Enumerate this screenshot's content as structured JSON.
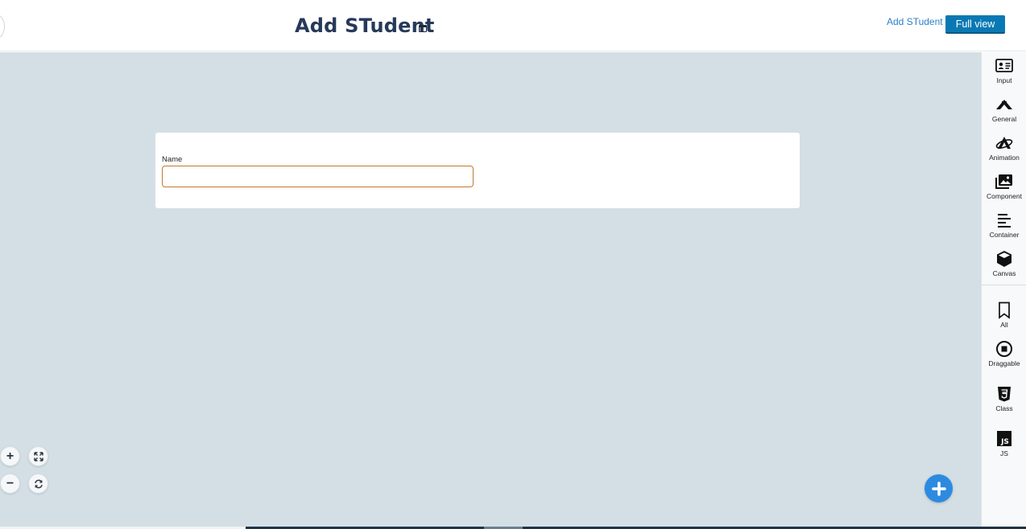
{
  "header": {
    "title": "Add STudent",
    "link_label": "Add STudent",
    "full_view_label": "Full view"
  },
  "form": {
    "name_label": "Name",
    "name_value": "",
    "name_placeholder": ""
  },
  "sidebar": {
    "items": [
      {
        "label": "Input",
        "icon": "id-card-icon"
      },
      {
        "label": "General",
        "icon": "general-icon"
      },
      {
        "label": "Animation",
        "icon": "animation-icon"
      },
      {
        "label": "Component",
        "icon": "images-icon"
      },
      {
        "label": "Container",
        "icon": "align-left-icon"
      },
      {
        "label": "Canvas",
        "icon": "cube-icon"
      },
      {
        "label": "All",
        "icon": "bookmark-icon"
      },
      {
        "label": "Draggable",
        "icon": "stop-circle-icon"
      },
      {
        "label": "Class",
        "icon": "css3-icon"
      },
      {
        "label": "JS",
        "icon": "js-icon"
      }
    ]
  },
  "zoom_controls": {
    "zoom_in": "+",
    "zoom_out": "−"
  },
  "colors": {
    "canvas_bg": "#d3dfe5",
    "title": "#26395a",
    "primary_button": "#0a79b3",
    "input_border": "#c5762d",
    "fab": "#2c8be0"
  }
}
